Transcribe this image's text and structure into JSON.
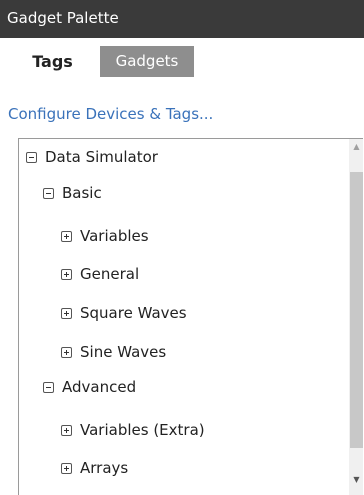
{
  "panel": {
    "title": "Gadget Palette"
  },
  "tabs": [
    {
      "label": "Tags",
      "active": true
    },
    {
      "label": "Gadgets",
      "active": false
    }
  ],
  "configure_link": "Configure Devices & Tags...",
  "tree": [
    {
      "label": "Data Simulator",
      "state": "expanded",
      "level": 0
    },
    {
      "label": "Basic",
      "state": "expanded",
      "level": 1
    },
    {
      "label": "Variables",
      "state": "collapsed",
      "level": 2
    },
    {
      "label": "General",
      "state": "collapsed",
      "level": 2
    },
    {
      "label": "Square Waves",
      "state": "collapsed",
      "level": 2
    },
    {
      "label": "Sine Waves",
      "state": "collapsed",
      "level": 2
    },
    {
      "label": "Advanced",
      "state": "expanded",
      "level": 1
    },
    {
      "label": "Variables (Extra)",
      "state": "collapsed",
      "level": 2
    },
    {
      "label": "Arrays",
      "state": "collapsed",
      "level": 2
    }
  ],
  "icons": {
    "expanded": "minus-box-icon",
    "collapsed": "plus-box-icon",
    "scroll_up": "up-arrow-icon",
    "scroll_down": "down-arrow-icon"
  },
  "colors": {
    "titlebar": "#3a3a3a",
    "inactive_tab": "#8e8e8e",
    "link": "#3a72ba"
  }
}
